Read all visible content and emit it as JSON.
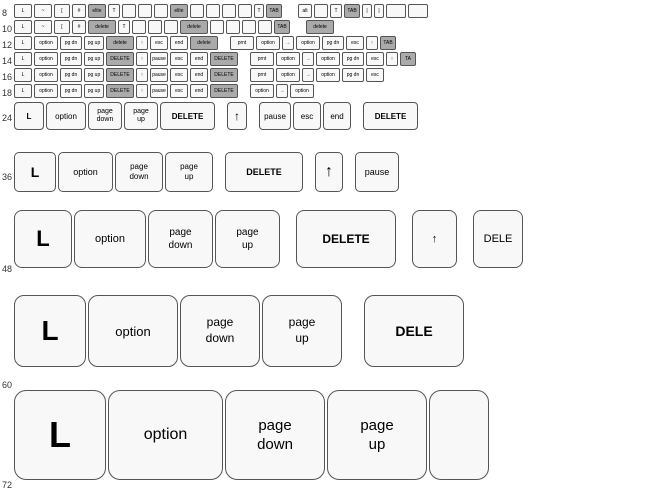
{
  "rows": [
    {
      "id": "row8",
      "size": "tiny",
      "lineNum": "8"
    },
    {
      "id": "row10",
      "size": "tiny",
      "lineNum": "10"
    },
    {
      "id": "row12",
      "size": "tiny",
      "lineNum": "12"
    },
    {
      "id": "row14",
      "size": "tiny",
      "lineNum": "14"
    },
    {
      "id": "row16",
      "size": "tiny",
      "lineNum": "16"
    },
    {
      "id": "row18",
      "size": "tiny",
      "lineNum": "18"
    },
    {
      "id": "row24",
      "size": "small",
      "lineNum": "24"
    },
    {
      "id": "row36",
      "size": "medium",
      "lineNum": "36"
    },
    {
      "id": "row48",
      "size": "large",
      "lineNum": "48"
    },
    {
      "id": "row60",
      "size": "xlarge",
      "lineNum": "60"
    },
    {
      "id": "row72",
      "size": "xxlarge",
      "lineNum": "72"
    }
  ],
  "keys": {
    "L": "L",
    "option": "option",
    "page_down": "page\ndown",
    "page_up": "page\nup",
    "DELETE": "DELETE",
    "arrow_up": "↑",
    "pause": "pause",
    "esc": "esc",
    "end": "end",
    "arrow_right": "→",
    "TAB": "TAB",
    "print_screen": "print\nscreen"
  }
}
